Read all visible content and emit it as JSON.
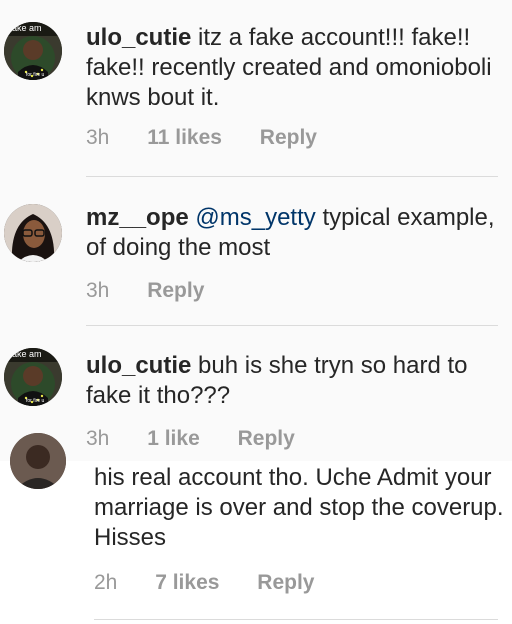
{
  "comments": [
    {
      "username": "ulo_cutie",
      "text": "itz a fake account!!! fake!! fake!! recently created and omonioboli knws bout it.",
      "time": "3h",
      "likes": "11 likes",
      "reply": "Reply",
      "avatar_icon": "fake-account-avatar",
      "avatar_text": "ake am",
      "avatar_subtext": "for fire u"
    },
    {
      "username": "mz__ope",
      "mention": "@ms_yetty",
      "text": "typical example, of doing the most",
      "time": "3h",
      "reply": "Reply",
      "avatar_icon": "woman-glasses-avatar"
    },
    {
      "username": "ulo_cutie",
      "text": "buh is she tryn so hard to fake it tho???",
      "time": "3h",
      "likes": "1 like",
      "reply": "Reply",
      "avatar_icon": "fake-account-avatar",
      "avatar_text": "ake am",
      "avatar_subtext": "for fire u"
    },
    {
      "text": "his real account tho. Uche Admit your marriage is over and stop the coverup. Hisses",
      "time": "2h",
      "likes": "7 likes",
      "reply": "Reply",
      "avatar_icon": "man-avatar-partial"
    }
  ],
  "colors": {
    "text": "#262626",
    "mention": "#003569",
    "meta": "#999999",
    "panel_bg": "#fafafa"
  }
}
